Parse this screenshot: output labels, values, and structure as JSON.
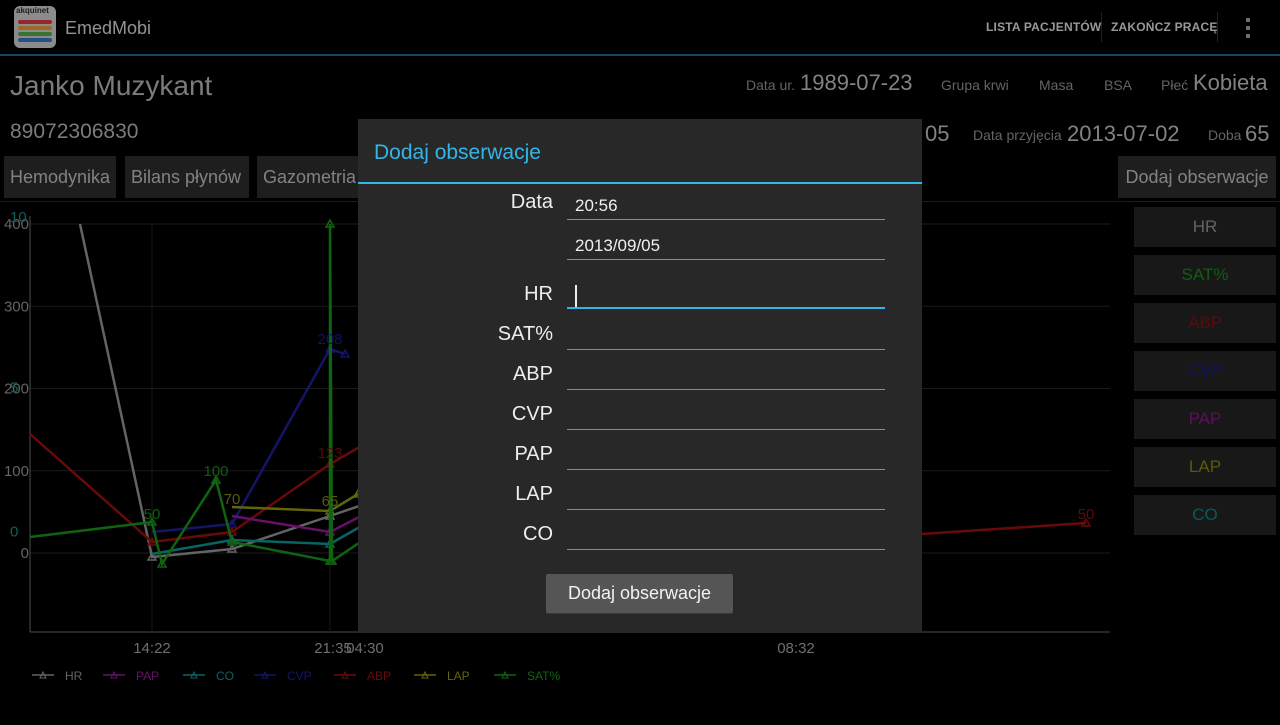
{
  "app": {
    "title": "EmedMobi",
    "logo_text": "akquinet",
    "logo_colors": [
      "#e63946",
      "#f1a33a",
      "#5ab04f",
      "#3a7ec8",
      "#8e44ad"
    ]
  },
  "actions": {
    "patient_list": "LISTA PACJENTÓW",
    "finish_work": "ZAKOŃCZ PRACĘ",
    "overflow_icon": "more-vert-icon"
  },
  "patient": {
    "name": "Janko Muzykant",
    "id": "89072306830",
    "dob_label": "Data ur.",
    "dob": "1989-07-23",
    "blood_label": "Grupa krwi",
    "mass_label": "Masa",
    "bsa_label": "BSA",
    "sex_label": "Płeć",
    "sex": "Kobieta",
    "partial_date": "05",
    "admission_label": "Data przyjęcia",
    "admission": "2013-07-02",
    "day_label": "Doba",
    "day": "65"
  },
  "tabs": [
    "Hemodynika",
    "Bilans płynów",
    "Gazometria"
  ],
  "add_obs_button": "Dodaj obserwacje",
  "series_buttons": [
    {
      "label": "HR",
      "color": "#9a9a9a"
    },
    {
      "label": "SAT%",
      "color": "#1a8f1a"
    },
    {
      "label": "ABP",
      "color": "#8b1010"
    },
    {
      "label": "CVP",
      "color": "#1a1a9a"
    },
    {
      "label": "PAP",
      "color": "#8a1a8a"
    },
    {
      "label": "LAP",
      "color": "#8a8a10"
    },
    {
      "label": "CO",
      "color": "#108a8a"
    }
  ],
  "chart_data": {
    "type": "line",
    "y_ticks": [
      "400",
      "300",
      "200",
      "100",
      "0"
    ],
    "y_ticks_alt": [
      {
        "text": "10",
        "color": "#1a8f8f"
      },
      {
        "text": "5",
        "color": "#1a8f8f"
      },
      {
        "text": "0",
        "color": "#1a8f8f"
      }
    ],
    "x_ticks": [
      "14:22",
      "21:35",
      "04:30",
      "08:32"
    ],
    "ylim": [
      0,
      400
    ],
    "data_labels": [
      {
        "text": "50",
        "series": "SAT%"
      },
      {
        "text": "100",
        "series": "SAT%"
      },
      {
        "text": "70",
        "series": "LAP"
      },
      {
        "text": "208",
        "series": "CVP"
      },
      {
        "text": "123",
        "series": "ABP"
      },
      {
        "text": "65",
        "series": "LAP"
      },
      {
        "text": "50",
        "series": "ABP"
      }
    ],
    "legend": [
      {
        "name": "HR",
        "color": "#9a9a9a"
      },
      {
        "name": "PAP",
        "color": "#a01aa0"
      },
      {
        "name": "CO",
        "color": "#109a9a"
      },
      {
        "name": "CVP",
        "color": "#2020a0"
      },
      {
        "name": "ABP",
        "color": "#a01010"
      },
      {
        "name": "LAP",
        "color": "#9a9a10"
      },
      {
        "name": "SAT%",
        "color": "#1a9a1a"
      }
    ],
    "legend_position": "bottom-left",
    "grid": true
  },
  "dialog": {
    "title": "Dodaj obserwacje",
    "date_label": "Data",
    "time_value": "20:56",
    "date_value": "2013/09/05",
    "fields": [
      "HR",
      "SAT%",
      "ABP",
      "CVP",
      "PAP",
      "LAP",
      "CO"
    ],
    "submit": "Dodaj obserwacje",
    "accent": "#33b5e5"
  }
}
